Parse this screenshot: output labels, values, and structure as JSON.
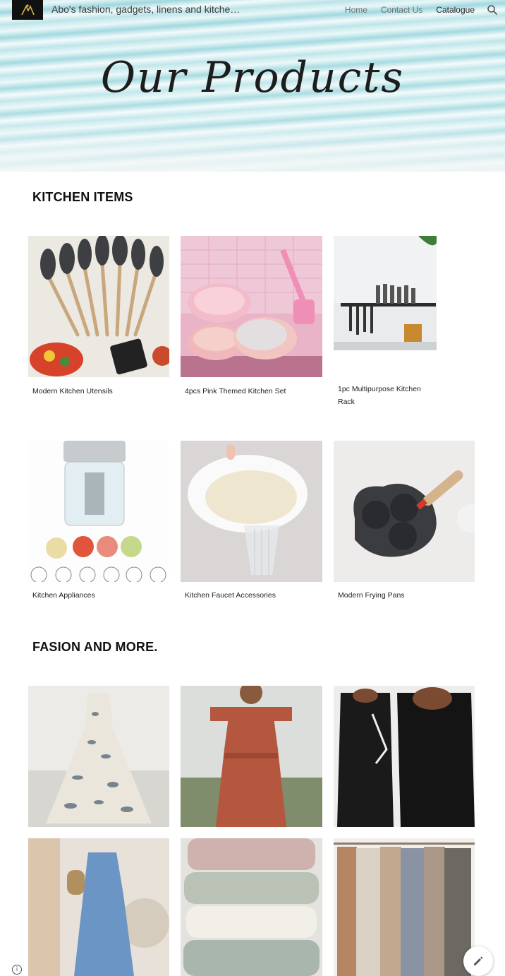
{
  "header": {
    "site_title": "Abo's fashion, gadgets, linens and kitche…",
    "nav": [
      "Home",
      "Contact Us",
      "Catalogue"
    ],
    "active_nav": "Catalogue"
  },
  "hero": {
    "title": "Our Products"
  },
  "sections": [
    {
      "title": "KITCHEN ITEMS",
      "products": [
        {
          "caption": "Modern Kitchen Utensils"
        },
        {
          "caption": "4pcs Pink Themed Kitchen Set"
        },
        {
          "caption": "1pc Multipurpose Kitchen Rack"
        },
        {
          "caption": "Kitchen Appliances"
        },
        {
          "caption": "Kitchen Faucet Accessories"
        },
        {
          "caption": "Modern Frying Pans"
        }
      ]
    },
    {
      "title": "FASION AND MORE.",
      "products": [
        {
          "caption": ""
        },
        {
          "caption": ""
        },
        {
          "caption": ""
        },
        {
          "caption": ""
        },
        {
          "caption": ""
        },
        {
          "caption": ""
        }
      ]
    }
  ],
  "colors": {
    "accent": "#111111",
    "hero_water": "#9dd7de"
  },
  "icons": [
    "site-logo",
    "search-icon",
    "info-icon",
    "edit-pencil-icon"
  ]
}
